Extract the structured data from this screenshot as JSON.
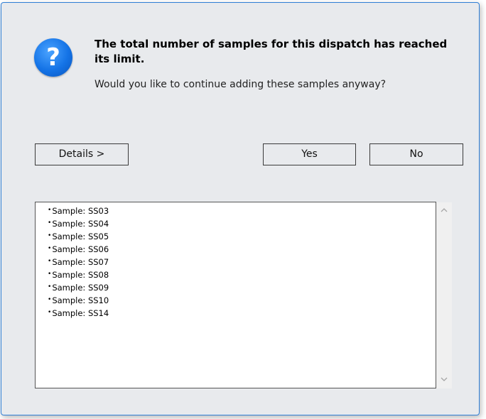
{
  "dialog": {
    "icon": "question-icon",
    "icon_glyph": "?",
    "title": "The total number of samples for this dispatch has reached its limit.",
    "message": "Would you like to continue adding these samples anyway?",
    "accent_color": "#1473e6"
  },
  "buttons": {
    "details": "Details >",
    "yes": "Yes",
    "no": "No"
  },
  "details": {
    "bullet": "•",
    "items": [
      "Sample: SS03",
      "Sample: SS04",
      "Sample: SS05",
      "Sample: SS06",
      "Sample: SS07",
      "Sample: SS08",
      "Sample: SS09",
      "Sample: SS10",
      "Sample: SS14"
    ]
  },
  "scrollbar": {
    "up_icon": "chevron-up-icon",
    "down_icon": "chevron-down-icon"
  }
}
